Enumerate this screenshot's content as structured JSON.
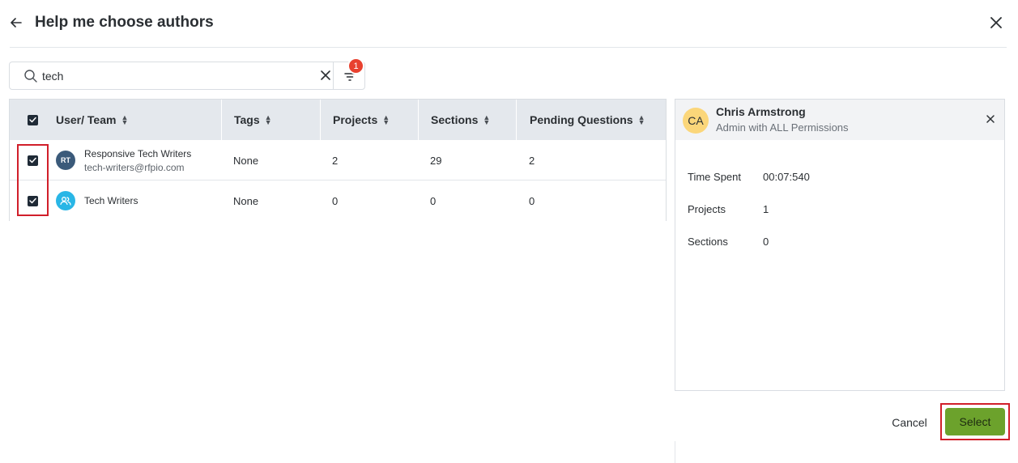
{
  "header": {
    "title": "Help me choose authors"
  },
  "search": {
    "value": "tech",
    "filter_count": "1"
  },
  "table": {
    "columns": [
      "User/ Team",
      "Tags",
      "Projects",
      "Sections",
      "Pending Questions"
    ],
    "rows": [
      {
        "avatar": "RT",
        "name": "Responsive Tech Writers",
        "email": "tech-writers@rfpio.com",
        "tags": "None",
        "projects": "2",
        "sections": "29",
        "pending": "2",
        "checked": true
      },
      {
        "avatar": "team-icon",
        "name": "Tech Writers",
        "email": "",
        "tags": "None",
        "projects": "0",
        "sections": "0",
        "pending": "0",
        "checked": true
      }
    ]
  },
  "detail": {
    "initials": "CA",
    "name": "Chris Armstrong",
    "role": "Admin with ALL Permissions",
    "stats": [
      {
        "label": "Time Spent",
        "value": "00:07:540"
      },
      {
        "label": "Projects",
        "value": "1"
      },
      {
        "label": "Sections",
        "value": "0"
      }
    ]
  },
  "footer": {
    "cancel_label": "Cancel",
    "select_label": "Select"
  },
  "colors": {
    "accent": "#6ca22c",
    "highlight": "#d11f2a",
    "badge": "#e8412f"
  }
}
